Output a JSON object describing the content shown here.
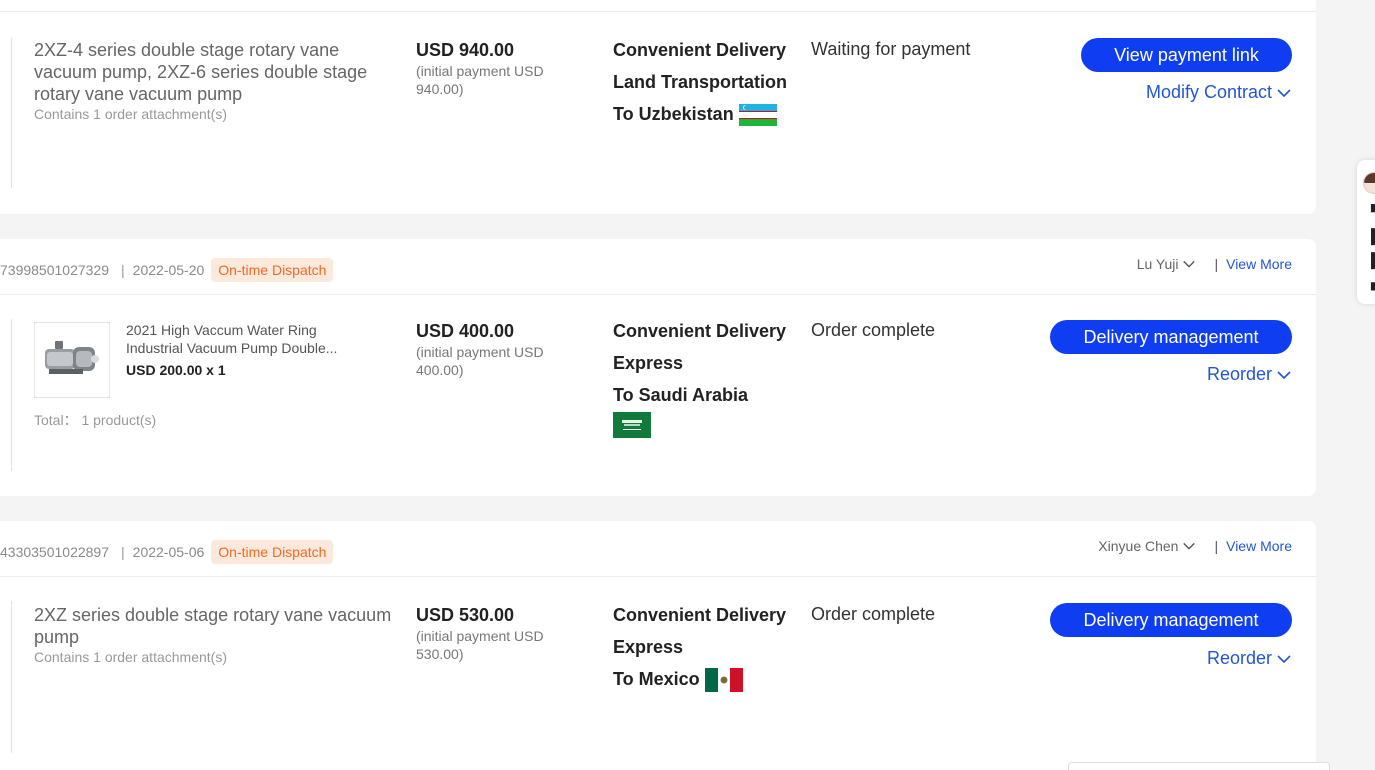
{
  "orders": [
    {
      "product_title": "2XZ-4 series double stage rotary vane vacuum pump, 2XZ-6 series double stage rotary vane vacuum pump",
      "attachments": "Contains 1 order attachment(s)",
      "amount": "USD 940.00",
      "initial_payment": "(initial payment USD 940.00)",
      "delivery_lines": [
        "Convenient Delivery",
        "Land Transportation"
      ],
      "destination": "To Uzbekistan",
      "flag_icon": "uzbekistan-flag-icon",
      "status": "Waiting for payment",
      "primary_action": "View payment link",
      "secondary_action": "Modify Contract"
    },
    {
      "order_id": "73998501027329",
      "date": "2022-05-20",
      "tag": "On-time Dispatch",
      "assignee": "Lu Yuji",
      "view_more": "View More",
      "product_name": "2021 High Vaccum Water Ring Industrial Vacuum Pump Double...",
      "product_price_qty": "USD 200.00 x 1",
      "total": "Total： 1 product(s)",
      "amount": "USD 400.00",
      "initial_payment": "(initial payment USD 400.00)",
      "delivery_lines": [
        "Convenient Delivery",
        "Express"
      ],
      "destination": "To Saudi Arabia",
      "flag_icon": "saudi-arabia-flag-icon",
      "status": "Order complete",
      "primary_action": "Delivery management",
      "secondary_action": "Reorder"
    },
    {
      "order_id": "43303501022897",
      "date": "2022-05-06",
      "tag": "On-time Dispatch",
      "assignee": "Xinyue Chen",
      "view_more": "View More",
      "product_title": "2XZ series double stage rotary vane vacuum pump",
      "attachments": "Contains 1 order attachment(s)",
      "amount": "USD 530.00",
      "initial_payment": "(initial payment USD 530.00)",
      "delivery_lines": [
        "Convenient Delivery",
        "Express"
      ],
      "destination": "To Mexico",
      "flag_icon": "mexico-flag-icon",
      "status": "Order complete",
      "primary_action": "Delivery management",
      "secondary_action": "Reorder"
    }
  ],
  "colors": {
    "primary": "#0f3ef2",
    "link": "#2255d6",
    "tag_bg": "#fde9dc",
    "tag_text": "#f06a22"
  }
}
